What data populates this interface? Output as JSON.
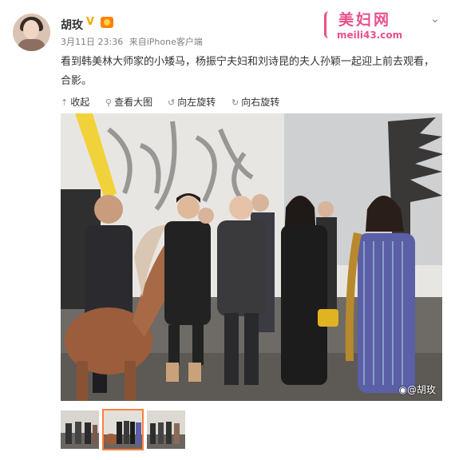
{
  "post": {
    "author_name": "胡玫",
    "verified_mark": "V",
    "date": "3月11日 23:36",
    "source_prefix": "来自",
    "source": "iPhone客户端",
    "text": "看到韩美林大师家的小矮马，杨振宁夫妇和刘诗昆的夫人孙颖一起迎上前去观看，合影。",
    "photo_watermark": "@胡玫"
  },
  "site_logo": {
    "name": "美妇网",
    "domain": "meili43.com"
  },
  "toolbar": {
    "collapse_label": "收起",
    "view_large_label": "查看大图",
    "rotate_left_label": "向左旋转",
    "rotate_right_label": "向右旋转"
  },
  "thumbnails": {
    "count": 3,
    "selected_index": 1
  },
  "colors": {
    "accent_orange": "#ff8140",
    "logo_pink": "#e8508c",
    "verified_gold": "#f7a600"
  }
}
